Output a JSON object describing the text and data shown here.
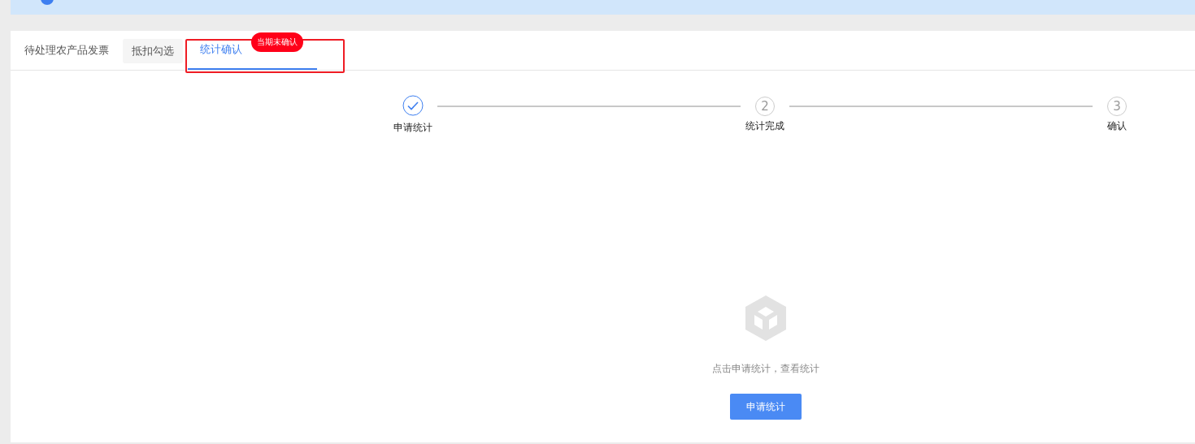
{
  "tabs": [
    {
      "label": "待处理农产品发票",
      "selected": false
    },
    {
      "label": "抵扣勾选",
      "selected": false,
      "hovered": true
    },
    {
      "label": "统计确认",
      "selected": true,
      "badge": "当期未确认",
      "highlighted": true
    }
  ],
  "steps": [
    {
      "label": "申请统计",
      "done": true
    },
    {
      "number": "2",
      "label": "统计完成",
      "done": false
    },
    {
      "number": "3",
      "label": "确认",
      "done": false
    }
  ],
  "empty": {
    "message": "点击申请统计，查看统计",
    "button": "申请统计"
  }
}
